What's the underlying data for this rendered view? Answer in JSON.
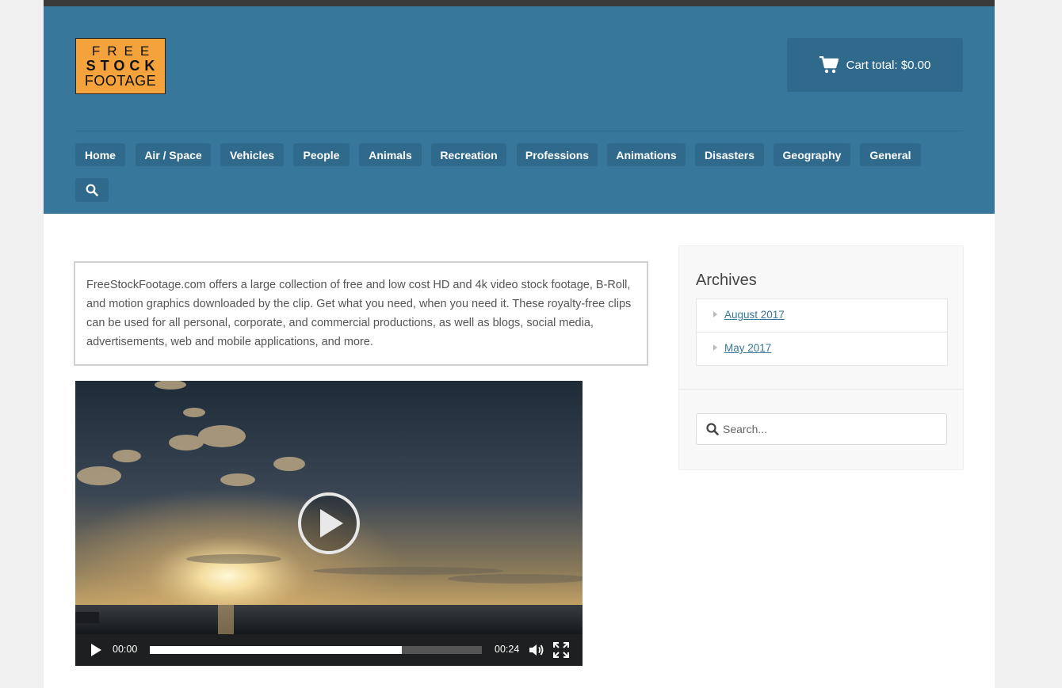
{
  "logo": {
    "line1": "FREE",
    "line2": "STOCK",
    "line3": "FOOTAGE"
  },
  "cart": {
    "label": "Cart total: $0.00",
    "icon": "shopping-cart-icon"
  },
  "nav": {
    "items": [
      {
        "label": "Home"
      },
      {
        "label": "Air / Space"
      },
      {
        "label": "Vehicles"
      },
      {
        "label": "People"
      },
      {
        "label": "Animals"
      },
      {
        "label": "Recreation"
      },
      {
        "label": "Professions"
      },
      {
        "label": "Animations"
      },
      {
        "label": "Disasters"
      },
      {
        "label": "Geography"
      },
      {
        "label": "General"
      }
    ],
    "search_icon": "search-icon"
  },
  "intro": {
    "text": "FreeStockFootage.com offers a large collection of free and low cost HD and 4k video stock footage, B-Roll, and motion graphics downloaded by the clip. Get what you need, when you need it. These royalty-free clips can be used for all personal, corporate, and commercial productions, as well as blogs, social media, advertisements, web and mobile applications, and more."
  },
  "video": {
    "current_time": "00:00",
    "duration": "00:24",
    "loaded_fraction": 0.76
  },
  "sidebar": {
    "archives_title": "Archives",
    "archives": [
      {
        "label": "August 2017"
      },
      {
        "label": "May 2017"
      }
    ],
    "search_placeholder": "Search..."
  },
  "colors": {
    "header": "#37779b",
    "nav_button": "#2f6a8c",
    "logo_bg": "#f4a23c",
    "link": "#37779b"
  }
}
